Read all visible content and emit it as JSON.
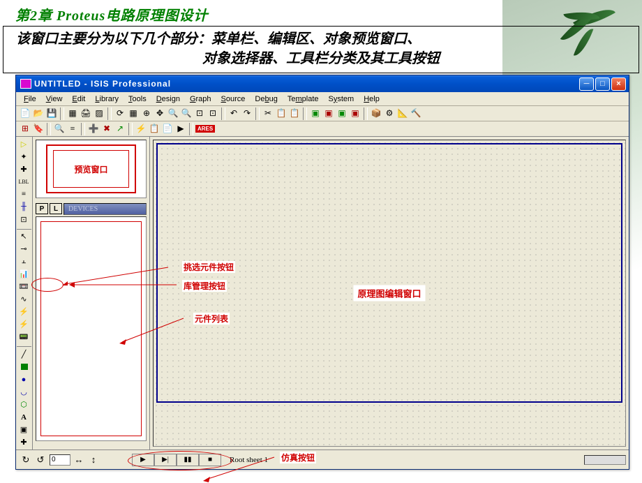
{
  "chapter_title": "第2章  Proteus电路原理图设计",
  "description_line1": "该窗口主要分为以下几个部分：菜单栏、编辑区、对象预览窗口、",
  "description_line2": "对象选择器、工具栏分类及其工具按钮",
  "window_title": "UNTITLED - ISIS Professional",
  "menu": {
    "file": "File",
    "view": "View",
    "edit": "Edit",
    "library": "Library",
    "tools": "Tools",
    "design": "Design",
    "graph": "Graph",
    "source": "Source",
    "debug": "Debug",
    "template": "Template",
    "system": "System",
    "help": "Help"
  },
  "preview_label": "预览窗口",
  "devices_header": "DEVICES",
  "p_btn": "P",
  "l_btn": "L",
  "canvas_label": "原理图编辑窗口",
  "annotations": {
    "pick_component": "挑选元件按钮",
    "lib_manage": "库管理按钮",
    "parts_list": "元件列表",
    "sim_button": "仿真按钮"
  },
  "ares_label": "ARES",
  "root_sheet": "Root sheet 1",
  "page_num": "0",
  "win_btns": {
    "min": "_",
    "max": "□",
    "close": "×"
  }
}
